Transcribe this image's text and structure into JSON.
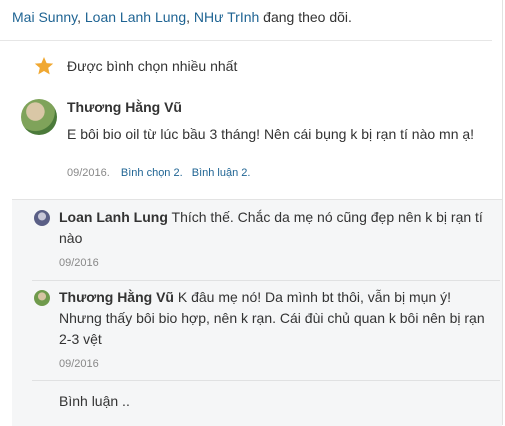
{
  "followers": {
    "names": [
      "Mai Sunny",
      "Loan Lanh Lung",
      "NHư TrInh"
    ],
    "separator": ", ",
    "suffix": " đang theo dõi."
  },
  "featured": {
    "icon": "star-icon",
    "icon_color": "#f0a832",
    "label": "Được bình chọn nhiều nhất"
  },
  "post": {
    "author": "Thương Hằng Vũ",
    "body": "E bôi bio oil từ lúc bầu 3 tháng! Nên cái bụng k bị rạn tí nào mn ạ!",
    "date": "09/2016.",
    "votes_link": "Bình chọn 2.",
    "comments_link": "Bình luận 2."
  },
  "comments": [
    {
      "author": "Loan Lanh Lung",
      "text": "Thích thế. Chắc da mẹ nó cũng đẹp nên k bị rạn tí nào",
      "date": "09/2016"
    },
    {
      "author": "Thương Hằng Vũ",
      "text": "K đâu mẹ nó! Da mình bt thôi, vẫn bị mụn ý! Nhưng thấy bôi bio hợp, nên k rạn. Cái đùi chủ quan k bôi nên bị rạn 2-3 vệt",
      "date": "09/2016"
    }
  ],
  "reply": {
    "placeholder": "Bình luận .."
  },
  "colors": {
    "link": "#1f6493",
    "thread_bg": "#f5f6f7",
    "meta": "#888888"
  }
}
